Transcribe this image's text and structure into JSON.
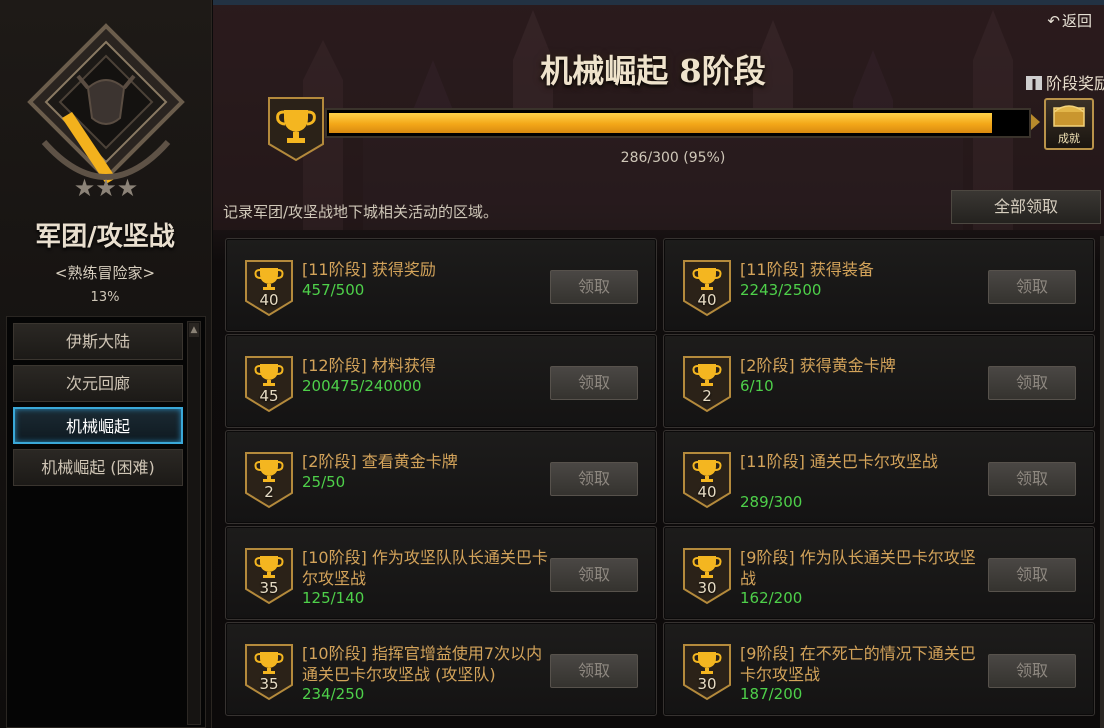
{
  "sidebar": {
    "category_title": "军团/攻坚战",
    "rank": "<熟练冒险家>",
    "percent": "13%",
    "items": [
      {
        "label": "伊斯大陆",
        "active": false
      },
      {
        "label": "次元回廊",
        "active": false
      },
      {
        "label": "机械崛起",
        "active": true
      },
      {
        "label": "机械崛起 (困难)",
        "active": false
      }
    ]
  },
  "header": {
    "back_label": "返回",
    "stage_title": "机械崛起 8阶段",
    "stage_reward_label": "阶段奖励",
    "achievement_badge_label": "成就",
    "progress": {
      "current": 286,
      "total": 300,
      "fraction": 0.95,
      "text": "286/300 (95%)"
    },
    "description": "记录军团/攻坚战地下城相关活动的区域。",
    "claim_all_label": "全部领取"
  },
  "tasks": [
    {
      "title": "[11阶段] 获得奖励",
      "progress": "457/500",
      "points": "40",
      "button": "领取"
    },
    {
      "title": "[11阶段] 获得装备",
      "progress": "2243/2500",
      "points": "40",
      "button": "领取"
    },
    {
      "title": "[12阶段] 材料获得",
      "progress": "200475/240000",
      "points": "45",
      "button": "领取"
    },
    {
      "title": "[2阶段] 获得黄金卡牌",
      "progress": "6/10",
      "points": "2",
      "button": "领取"
    },
    {
      "title": "[2阶段] 查看黄金卡牌",
      "progress": "25/50",
      "points": "2",
      "button": "领取"
    },
    {
      "title": "[11阶段] 通关巴卡尔攻坚战",
      "progress": "289/300",
      "points": "40",
      "button": "领取"
    },
    {
      "title": "[10阶段] 作为攻坚队队长通关巴卡尔攻坚战",
      "progress": "125/140",
      "points": "35",
      "button": "领取"
    },
    {
      "title": "[9阶段] 作为队长通关巴卡尔攻坚战",
      "progress": "162/200",
      "points": "30",
      "button": "领取"
    },
    {
      "title": "[10阶段] 指挥官增益使用7次以内通关巴卡尔攻坚战 (攻坚队)",
      "progress": "234/250",
      "points": "35",
      "button": "领取"
    },
    {
      "title": "[9阶段] 在不死亡的情况下通关巴卡尔攻坚战",
      "progress": "187/200",
      "points": "30",
      "button": "领取"
    }
  ],
  "colors": {
    "accent_gold": "#f3a718",
    "task_title": "#d3a35a",
    "task_progress": "#4ed04a",
    "active_nav_border": "#3aa8d8"
  }
}
